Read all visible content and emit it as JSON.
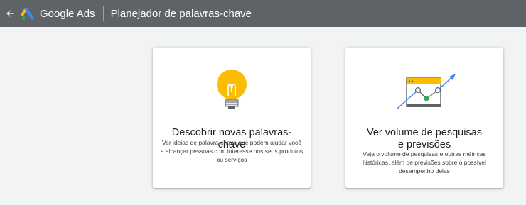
{
  "topbar": {
    "back_icon": "arrow-back-icon",
    "logo_icon": "google-ads-logo-icon",
    "product_name": "Google Ads",
    "page_title": "Planejador de palavras-chave"
  },
  "cards": [
    {
      "icon": "lightbulb-icon",
      "title": "Descobrir novas palavras-chave",
      "description": "Ver ideias de palavra-chave que podem ajudar você a alcançar pessoas com interesse nos seus produtos ou serviços"
    },
    {
      "icon": "forecast-chart-icon",
      "title": "Ver volume de pesquisas e previsões",
      "description": "Veja o volume de pesquisas e outras métricas históricas, além de previsões sobre o possível desempenho delas"
    }
  ],
  "colors": {
    "topbar": "#5f6368",
    "background": "#f1f3f4",
    "bulb": "#fbbc04",
    "forecast_arrow": "#4285f4",
    "forecast_point": "#34a853"
  }
}
